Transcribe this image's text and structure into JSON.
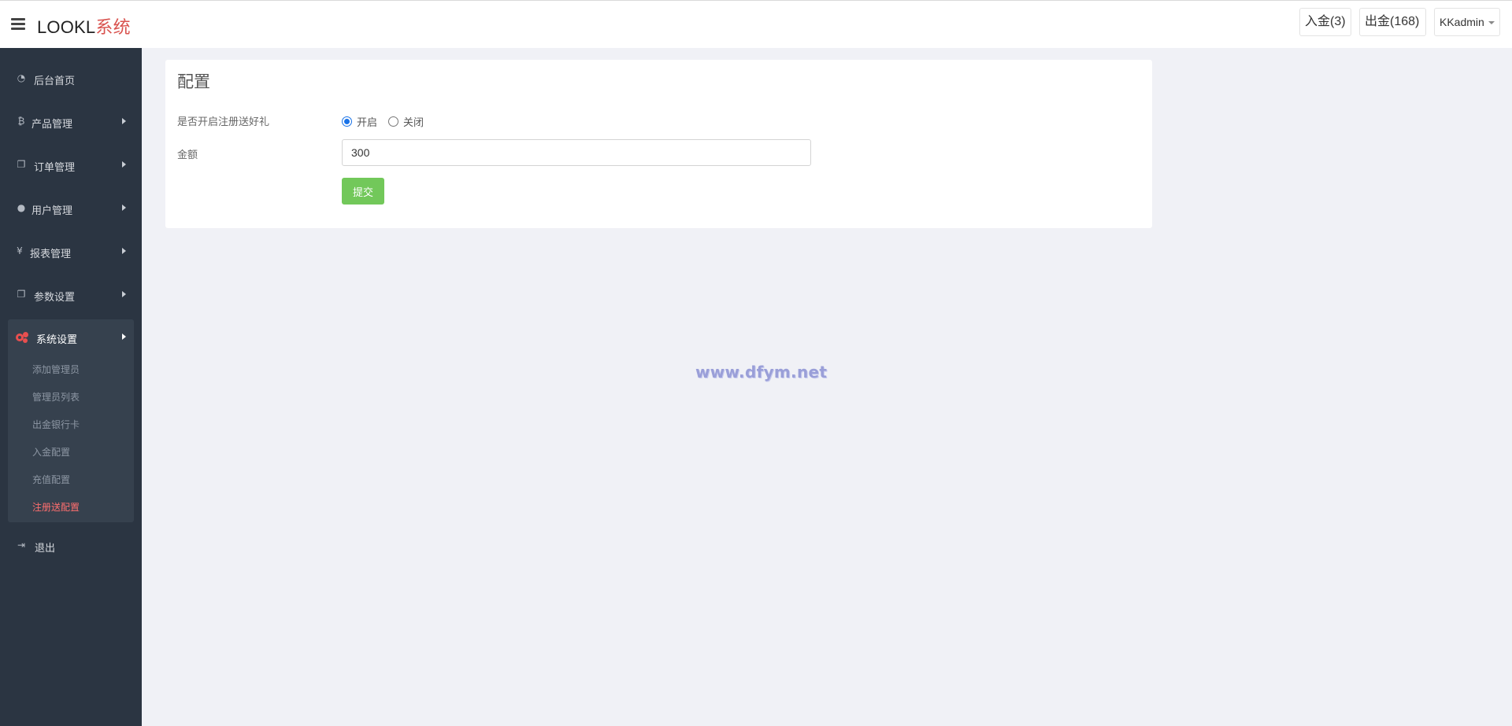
{
  "header": {
    "brand_main": "LOOKL",
    "brand_accent": "系统",
    "deposit_label": "入金(3)",
    "withdraw_label": "出金(168)",
    "user_label": "KKadmin"
  },
  "sidebar": {
    "items": [
      {
        "label": "后台首页",
        "icon": "dashboard-icon"
      },
      {
        "label": "产品管理",
        "icon": "bitcoin-icon"
      },
      {
        "label": "订单管理",
        "icon": "copy-icon"
      },
      {
        "label": "用户管理",
        "icon": "user-icon"
      },
      {
        "label": "报表管理",
        "icon": "yen-icon"
      },
      {
        "label": "参数设置",
        "icon": "copy-icon"
      },
      {
        "label": "系统设置",
        "icon": "gears-icon"
      },
      {
        "label": "退出",
        "icon": "sign-out-icon"
      }
    ],
    "submenu": [
      {
        "label": "添加管理员"
      },
      {
        "label": "管理员列表"
      },
      {
        "label": "出金银行卡"
      },
      {
        "label": "入金配置"
      },
      {
        "label": "充值配置"
      },
      {
        "label": "注册送配置",
        "active": true
      }
    ]
  },
  "main": {
    "title": "配置",
    "register_gift_label": "是否开启注册送好礼",
    "radio_on": "开启",
    "radio_off": "关闭",
    "selected": "开启",
    "amount_label": "金额",
    "amount_value": "300",
    "submit_label": "提交"
  },
  "watermark": "www.dfym.net",
  "colors": {
    "sidebar_bg": "#2b3542",
    "accent_red": "#e84f4f",
    "submit_green": "#72c85a",
    "radio_blue": "#1a73e8"
  }
}
